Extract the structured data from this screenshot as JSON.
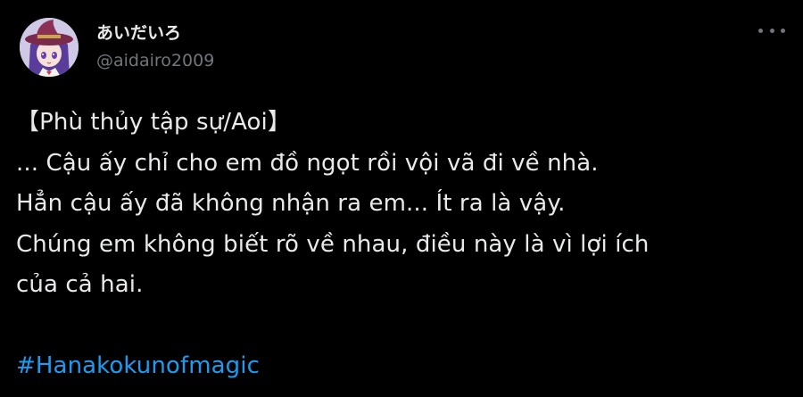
{
  "user": {
    "display_name": "あいだいろ",
    "handle": "@aidairo2009",
    "avatar_icon": "user-avatar-icon"
  },
  "menu": {
    "icon": "more-icon"
  },
  "tweet": {
    "lines": [
      "【Phù thủy tập sự/Aoi】",
      "... Cậu ấy chỉ cho em đồ ngọt rồi vội vã đi về nhà.",
      "Hẳn cậu ấy đã không nhận ra em... Ít ra là vậy.",
      "Chúng em không biết rõ về nhau, điều này là vì lợi ích",
      "của cả hai."
    ],
    "hashtag": "#Hanakokunofmagic"
  },
  "colors": {
    "background": "#000000",
    "text": "#e7e9ea",
    "secondary": "#71767b",
    "link": "#1d9bf0"
  }
}
